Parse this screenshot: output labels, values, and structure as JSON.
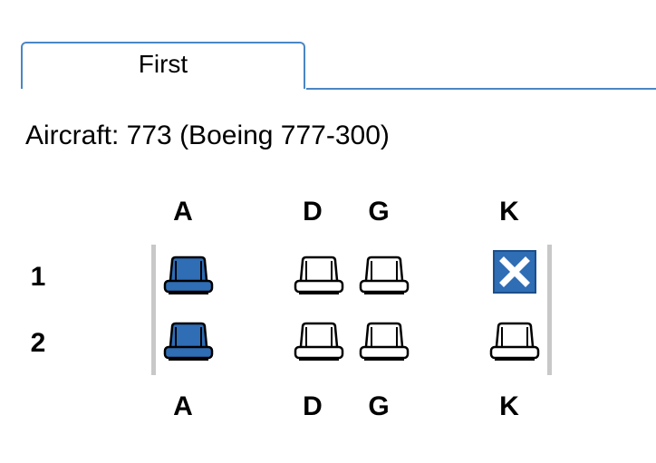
{
  "tab": {
    "label": "First"
  },
  "aircraft": {
    "text": "Aircraft: 773 (Boeing 777-300)"
  },
  "columns_top": [
    "A",
    "D",
    "G",
    "K"
  ],
  "columns_bottom": [
    "A",
    "D",
    "G",
    "K"
  ],
  "rows": [
    {
      "label": "1",
      "seats": [
        {
          "col": "A",
          "status": "selected"
        },
        {
          "col": "D",
          "status": "available"
        },
        {
          "col": "G",
          "status": "available"
        },
        {
          "col": "K",
          "status": "unavailable"
        }
      ]
    },
    {
      "label": "2",
      "seats": [
        {
          "col": "A",
          "status": "selected"
        },
        {
          "col": "D",
          "status": "available"
        },
        {
          "col": "G",
          "status": "available"
        },
        {
          "col": "K",
          "status": "available"
        }
      ]
    }
  ],
  "colors": {
    "tab_border": "#4a86c5",
    "seat_selected": "#2f6db5",
    "seat_unavailable": "#2f6db5",
    "bulkhead": "#c8c8c8"
  }
}
